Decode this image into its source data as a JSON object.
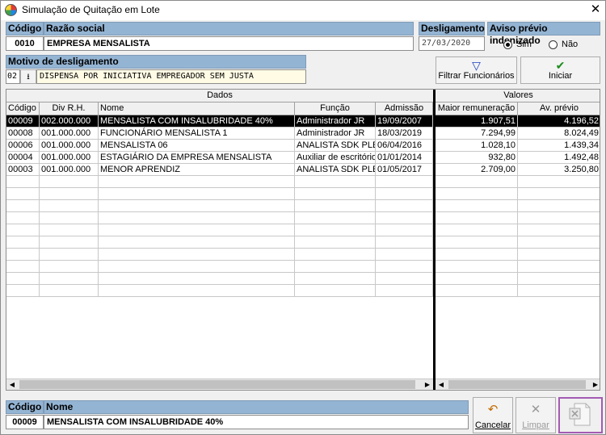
{
  "window": {
    "title": "Simulação de Quitação em Lote",
    "close_glyph": "✕"
  },
  "header": {
    "codigo_label": "Código",
    "codigo_value": "0010",
    "razao_label": "Razão social",
    "razao_value": "EMPRESA MENSALISTA",
    "desligamento_label": "Desligamento",
    "desligamento_value": "27/03/2020",
    "aviso_label": "Aviso prévio indenizado",
    "aviso_options": [
      "Sim",
      "Não"
    ],
    "aviso_selected": "Sim"
  },
  "motivo": {
    "label": "Motivo de desligamento",
    "code": "02",
    "text": "DISPENSA POR INICIATIVA EMPREGADOR SEM JUSTA"
  },
  "buttons": {
    "filtrar": "Filtrar Funcionários",
    "iniciar": "Iniciar",
    "cancelar": "Cancelar",
    "limpar": "Limpar"
  },
  "grid": {
    "groups": [
      "Dados",
      "Valores"
    ],
    "columns": [
      "Código",
      "Div R.H.",
      "Nome",
      "Função",
      "Admissão",
      "Maior remuneração",
      "Av. prévio"
    ],
    "rows": [
      [
        "00009",
        "002.000.000",
        "MENSALISTA COM INSALUBRIDADE 40%",
        "Administrador JR",
        "19/09/2007",
        "1.907,51",
        "4.196,52"
      ],
      [
        "00008",
        "001.000.000",
        "FUNCIONÁRIO MENSALISTA 1",
        "Administrador JR",
        "18/03/2019",
        "7.294,99",
        "8.024,49"
      ],
      [
        "00006",
        "001.000.000",
        "MENSALISTA 06",
        "ANALISTA SDK PLENO",
        "06/04/2016",
        "1.028,10",
        "1.439,34"
      ],
      [
        "00004",
        "001.000.000",
        "ESTAGIÁRIO DA EMPRESA MENSALISTA",
        "Auxiliar de escritório",
        "01/01/2014",
        "932,80",
        "1.492,48"
      ],
      [
        "00003",
        "001.000.000",
        "MENOR APRENDIZ",
        "ANALISTA SDK PLENO",
        "01/05/2017",
        "2.709,00",
        "3.250,80"
      ]
    ],
    "selected_row": 0
  },
  "footer": {
    "codigo_label": "Código",
    "codigo_value": "00009",
    "nome_label": "Nome",
    "nome_value": "MENSALISTA COM INSALUBRIDADE 40%"
  },
  "colors": {
    "header_blue": "#94b4d3",
    "selection": "#000000",
    "highlight_border": "#a35bb3"
  }
}
